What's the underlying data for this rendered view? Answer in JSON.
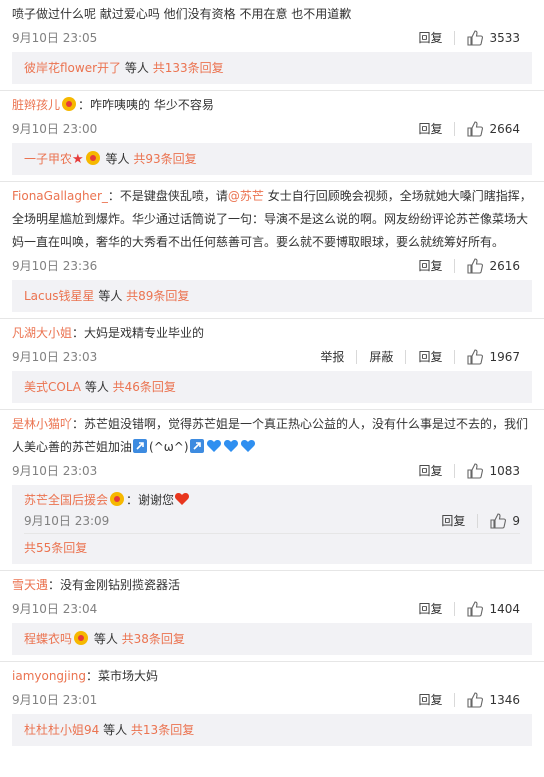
{
  "comments": [
    {
      "text": "喷子做过什么呢 献过爱心吗 他们没有资格 不用在意 也不用道歉",
      "time": "9月10日 23:05",
      "reply_label": "回复",
      "likes": "3533",
      "reply_summary": {
        "user": "彼岸花flower开了",
        "mid": " 等人 ",
        "count": "共133条回复"
      }
    },
    {
      "user": "脏辫孩儿",
      "text": "：咋咋咦咦的 华少不容易",
      "time": "9月10日 23:00",
      "reply_label": "回复",
      "likes": "2664",
      "reply_summary": {
        "user": "一子甲农",
        "mid": " 等人 ",
        "count": "共93条回复"
      }
    },
    {
      "user": "FionaGallagher_",
      "text_1": "：不是键盘侠乱喷，请",
      "mention": "@苏芒",
      "text_2": " 女士自行回顾晚会视频，全场就她大嗓门瞎指挥，全场明星尴尬到爆炸。华少通过话筒说了一句：导演不是这么说的啊。网友纷纷评论苏芒像菜场大妈一直在叫唤，奢华的大秀看不出任何慈善可言。要么就不要博取眼球，要么就统筹好所有。",
      "time": "9月10日 23:36",
      "reply_label": "回复",
      "likes": "2616",
      "reply_summary": {
        "user": "Lacus钱星星",
        "mid": " 等人 ",
        "count": "共89条回复"
      }
    },
    {
      "user": "凡湖大小姐",
      "text": "：大妈是戏精专业毕业的",
      "time": "9月10日 23:03",
      "report_label": "举报",
      "block_label": "屏蔽",
      "reply_label": "回复",
      "likes": "1967",
      "reply_summary": {
        "user": "美式COLA",
        "mid": " 等人 ",
        "count": "共46条回复"
      }
    },
    {
      "user": "是林小猫吖",
      "text": "：苏芒姐没错啊，觉得苏芒姐是一个真正热心公益的人，没有什么事是过不去的，我们人美心善的苏芒姐加油",
      "kaomoji": "(^ω^)",
      "time": "9月10日 23:03",
      "reply_label": "回复",
      "likes": "1083",
      "sub_reply": {
        "user": "苏芒全国后援会",
        "text": "：谢谢您",
        "time": "9月10日 23:09",
        "reply_label": "回复",
        "likes": "9"
      },
      "reply_summary": {
        "count": "共55条回复"
      }
    },
    {
      "user": "雪天遇",
      "text": "：没有金刚钻别揽瓷器活",
      "time": "9月10日 23:04",
      "reply_label": "回复",
      "likes": "1404",
      "reply_summary": {
        "user": "程蝶衣吗",
        "mid": " 等人 ",
        "count": "共38条回复"
      }
    },
    {
      "user": "iamyongjing",
      "text": "：菜市场大妈",
      "time": "9月10日 23:01",
      "reply_label": "回复",
      "likes": "1346",
      "reply_summary": {
        "user": "杜杜杜小姐94",
        "mid": " 等人 ",
        "count": "共13条回复"
      }
    }
  ],
  "colors": {
    "link": "#eb7350",
    "reply_bg": "#f2f2f5",
    "meta": "#808080",
    "heart_blue": "#2f8ff0"
  },
  "icons": [
    "thumbs-up-icon",
    "vip-badge-icon",
    "red-star-icon",
    "blue-heart-icon",
    "red-heart-icon",
    "arrow-box-icon"
  ]
}
